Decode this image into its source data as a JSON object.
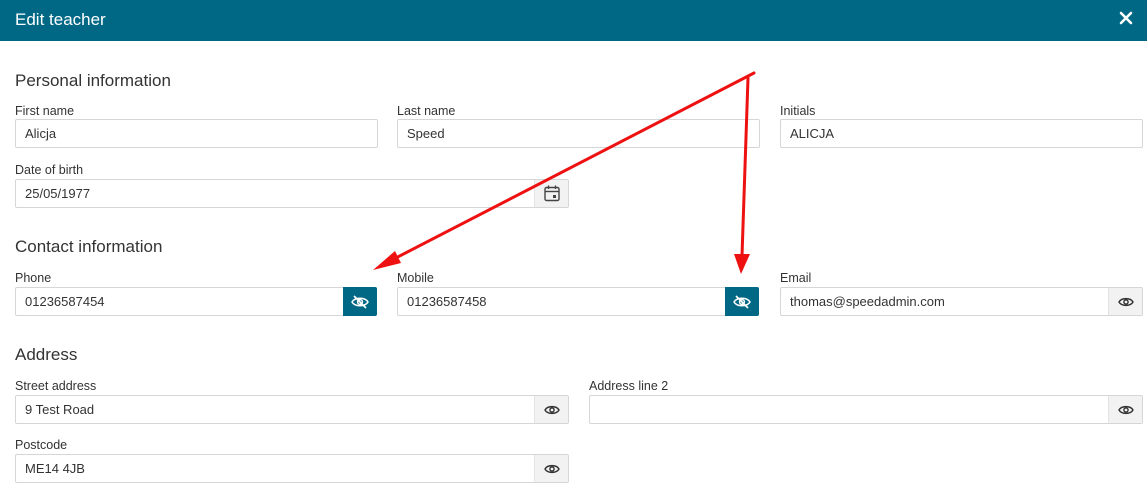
{
  "dialog": {
    "title": "Edit teacher"
  },
  "sections": {
    "personal": "Personal information",
    "contact": "Contact information",
    "address": "Address"
  },
  "fields": {
    "first_name": {
      "label": "First name",
      "value": "Alicja"
    },
    "last_name": {
      "label": "Last name",
      "value": "Speed"
    },
    "initials": {
      "label": "Initials",
      "value": "ALICJA"
    },
    "dob": {
      "label": "Date of birth",
      "value": "25/05/1977"
    },
    "phone": {
      "label": "Phone",
      "value": "01236587454"
    },
    "mobile": {
      "label": "Mobile",
      "value": "01236587458"
    },
    "email": {
      "label": "Email",
      "value": "thomas@speedadmin.com"
    },
    "street": {
      "label": "Street address",
      "value": "9 Test Road"
    },
    "address2": {
      "label": "Address line 2",
      "value": ""
    },
    "postcode": {
      "label": "Postcode",
      "value": "ME14 4JB"
    }
  },
  "icons": {
    "close": "close-icon",
    "calendar": "calendar-icon",
    "eye": "eye-icon",
    "eye_slash": "eye-slash-icon"
  },
  "colors": {
    "brand": "#006885",
    "annotation_arrow": "#ee1111"
  }
}
